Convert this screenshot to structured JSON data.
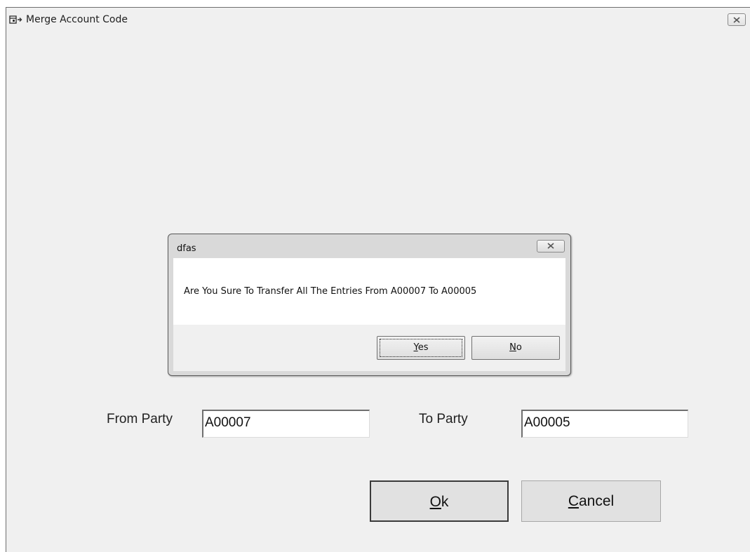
{
  "window": {
    "title": "Merge Account Code"
  },
  "form": {
    "from_party_label": "From Party",
    "from_party_value": "A00007",
    "to_party_label": "To Party",
    "to_party_value": "A00005",
    "ok_label": "Ok",
    "cancel_label": "Cancel"
  },
  "dialog": {
    "title": "dfas",
    "message": "Are You Sure To Transfer All The Entries From A00007 To A00005",
    "yes_label": "Yes",
    "no_label": "No"
  },
  "icons": {
    "app": "app-window-icon",
    "close": "close-icon"
  }
}
